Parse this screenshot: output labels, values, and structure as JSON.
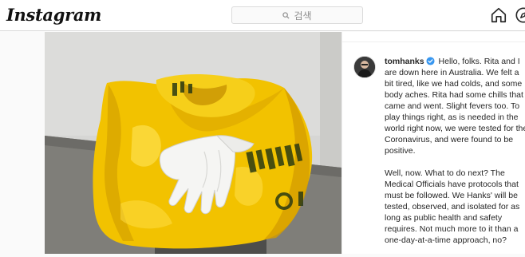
{
  "app": {
    "logo_text": "Instagram"
  },
  "search": {
    "placeholder": "검색"
  },
  "nav": {
    "home_icon": "home-icon",
    "explore_icon": "compass-icon"
  },
  "post": {
    "image_description_icon": "post-photo",
    "author": {
      "username": "tomhanks",
      "verified": true,
      "verified_color": "#3897f0"
    },
    "caption_paragraphs": [
      "Hello, folks. Rita and I are down here in Australia. We felt a bit tired, like we had colds, and some body aches. Rita had some chills that came and went. Slight fevers too. To play things right, as is needed in the world right now, we were tested for the Coronavirus, and were found to be positive.",
      "Well, now. What to do next? The Medical Officials have protocols that must be followed. We Hanks' will be tested, observed, and isolated for as long as public health and safety requires. Not much more to it than a one-day-at-a-time approach, no?"
    ]
  },
  "colors": {
    "background": "#fafafa",
    "border": "#dbdbdb",
    "text": "#262626",
    "bag_yellow": "#f2c200"
  }
}
